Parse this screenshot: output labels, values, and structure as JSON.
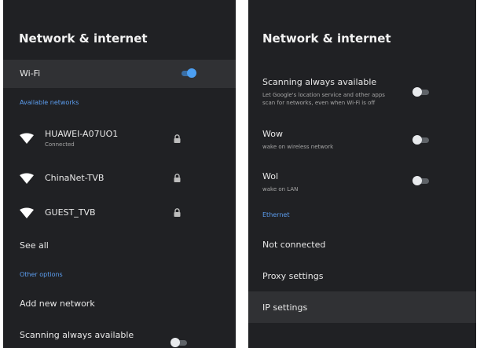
{
  "left": {
    "title": "Network & internet",
    "wifi": {
      "label": "Wi-Fi",
      "toggle_on": true
    },
    "available_header": "Available networks",
    "networks": [
      {
        "name": "HUAWEI-A07UO1",
        "status": "Connected",
        "icon": "wifi-icon",
        "secured": true
      },
      {
        "name": "ChinaNet-TVB",
        "status": "",
        "icon": "wifi-icon",
        "secured": true
      },
      {
        "name": "GUEST_TVB",
        "status": "",
        "icon": "wifi-icon",
        "secured": true
      }
    ],
    "see_all": "See all",
    "other_header": "Other options",
    "add_network": "Add new network",
    "scanning": {
      "label": "Scanning always available",
      "toggle_on": false
    }
  },
  "right": {
    "title": "Network & internet",
    "scanning": {
      "label": "Scanning always available",
      "desc_line1": "Let Google's location service and other apps",
      "desc_line2": "scan for networks, even when Wi-Fi is off",
      "toggle_on": false
    },
    "wow": {
      "label": "Wow",
      "desc": "wake on wireless network",
      "toggle_on": false
    },
    "wol": {
      "label": "Wol",
      "desc": "wake on LAN",
      "toggle_on": false
    },
    "ethernet_header": "Ethernet",
    "not_connected": "Not connected",
    "proxy": "Proxy settings",
    "ip": "IP settings"
  },
  "colors": {
    "panel_bg": "#202124",
    "highlight_bg": "#303134",
    "accent": "#5c9ef0",
    "toggle_on": "#4c9ff2"
  }
}
